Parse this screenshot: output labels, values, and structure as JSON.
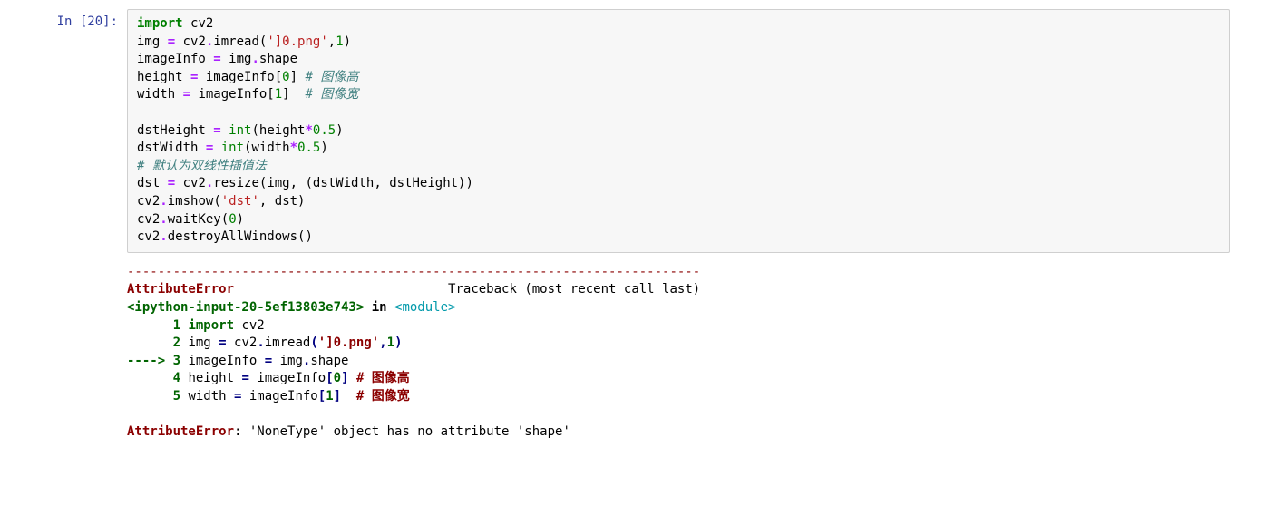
{
  "prompt": {
    "label": "In [20]:"
  },
  "code": {
    "l1": {
      "kw": "import",
      "mod": "cv2"
    },
    "l2": {
      "a": "img ",
      "op": "=",
      "b": " cv2",
      "dot": ".",
      "fn": "imread",
      "lp": "(",
      "str": "']0.png'",
      "comma": ",",
      "num": "1",
      "rp": ")"
    },
    "l3": {
      "a": "imageInfo ",
      "op": "=",
      "b": " img",
      "dot": ".",
      "attr": "shape"
    },
    "l4": {
      "a": "height ",
      "op": "=",
      "b": " imageInfo[",
      "num": "0",
      "rb": "] ",
      "comment": "# 图像高"
    },
    "l5": {
      "a": "width ",
      "op": "=",
      "b": " imageInfo[",
      "num": "1",
      "rb": "]  ",
      "comment": "# 图像宽"
    },
    "l7": {
      "a": "dstHeight ",
      "op": "=",
      "sp": " ",
      "fn": "int",
      "lp": "(",
      "arg": "height",
      "star": "*",
      "num": "0.5",
      "rp": ")"
    },
    "l8": {
      "a": "dstWidth ",
      "op": "=",
      "sp": " ",
      "fn": "int",
      "lp": "(",
      "arg": "width",
      "star": "*",
      "num": "0.5",
      "rp": ")"
    },
    "l9": {
      "comment": "# 默认为双线性插值法"
    },
    "l10": {
      "a": "dst ",
      "op": "=",
      "b": " cv2",
      "dot": ".",
      "fn": "resize",
      "lp": "(",
      "args": "img, (dstWidth, dstHeight))"
    },
    "l11": {
      "a": "cv2",
      "dot": ".",
      "fn": "imshow",
      "lp": "(",
      "str": "'dst'",
      "rest": ", dst)"
    },
    "l12": {
      "a": "cv2",
      "dot": ".",
      "fn": "waitKey",
      "lp": "(",
      "num": "0",
      "rp": ")"
    },
    "l13": {
      "a": "cv2",
      "dot": ".",
      "fn": "destroyAllWindows",
      "lp": "(",
      "rp": ")"
    }
  },
  "error": {
    "dashes": "---------------------------------------------------------------------------",
    "name": "AttributeError",
    "traceback_label": "Traceback (most recent call last)",
    "file": "<ipython-input-20-5ef13803e743>",
    "in_word": " in ",
    "module": "<module>",
    "lines": {
      "l1": {
        "num": "      1 ",
        "kw": "import",
        "rest": " cv2"
      },
      "l2": {
        "num": "      2 ",
        "a": "img ",
        "op": "=",
        "b": " cv2",
        "dot": ".",
        "fn": "imread",
        "lp": "(",
        "str": "']0.png'",
        "comma": ",",
        "n": "1",
        "rp": ")"
      },
      "l3": {
        "arrow": "----> 3 ",
        "a": "imageInfo ",
        "op": "=",
        "b": " img",
        "dot": ".",
        "attr": "shape"
      },
      "l4": {
        "num": "      4 ",
        "a": "height ",
        "op": "=",
        "b": " imageInfo",
        "lb": "[",
        "n": "0",
        "rb": "]",
        "sp": " ",
        "comment": "# 图像高"
      },
      "l5": {
        "num": "      5 ",
        "a": "width ",
        "op": "=",
        "b": " imageInfo",
        "lb": "[",
        "n": "1",
        "rb": "]",
        "sp": "  ",
        "comment": "# 图像宽"
      }
    },
    "final_name": "AttributeError",
    "final_msg": ": 'NoneType' object has no attribute 'shape'"
  }
}
